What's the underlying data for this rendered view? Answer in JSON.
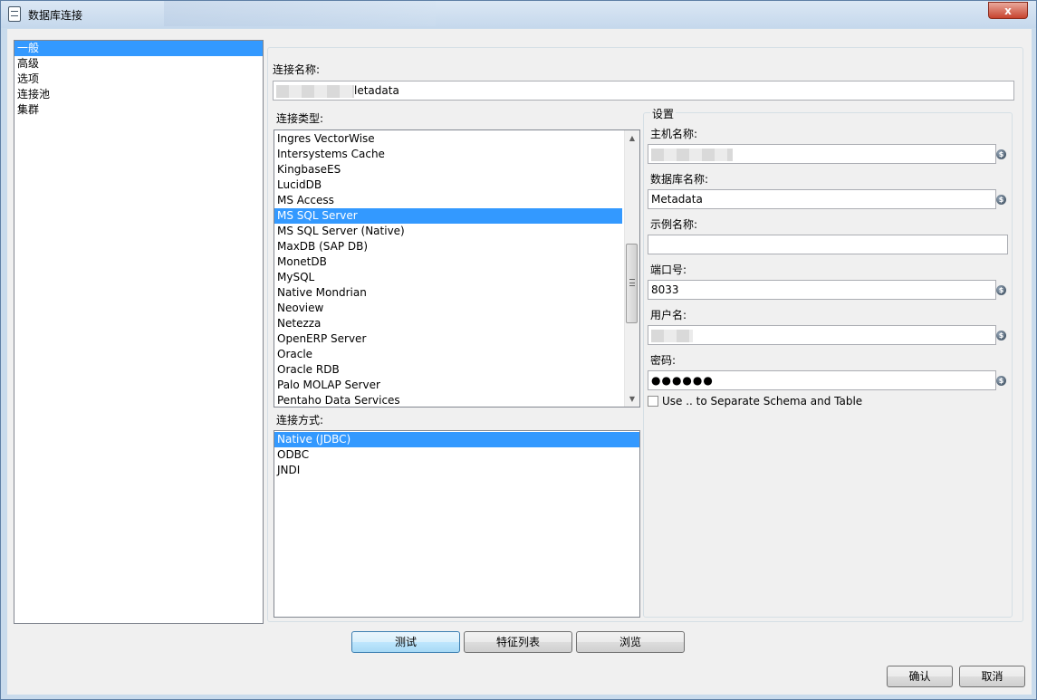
{
  "window": {
    "title": "数据库连接",
    "close_symbol": "x"
  },
  "nav": {
    "items": [
      {
        "label": "一般",
        "selected": true
      },
      {
        "label": "高级",
        "selected": false
      },
      {
        "label": "选项",
        "selected": false
      },
      {
        "label": "连接池",
        "selected": false
      },
      {
        "label": "集群",
        "selected": false
      }
    ]
  },
  "connection_name": {
    "label": "连接名称:",
    "value": "letadata"
  },
  "connection_type": {
    "label": "连接类型:",
    "items": [
      "Ingres VectorWise",
      "Intersystems Cache",
      "KingbaseES",
      "LucidDB",
      "MS Access",
      "MS SQL Server",
      "MS SQL Server (Native)",
      "MaxDB (SAP DB)",
      "MonetDB",
      "MySQL",
      "Native Mondrian",
      "Neoview",
      "Netezza",
      "OpenERP Server",
      "Oracle",
      "Oracle RDB",
      "Palo MOLAP Server",
      "Pentaho Data Services"
    ],
    "selected": "MS SQL Server"
  },
  "access_method": {
    "label": "连接方式:",
    "items": [
      "Native (JDBC)",
      "ODBC",
      "JNDI"
    ],
    "selected": "Native (JDBC)"
  },
  "settings": {
    "group_label": "设置",
    "host": {
      "label": "主机名称:",
      "value": ""
    },
    "database": {
      "label": "数据库名称:",
      "value": "Metadata"
    },
    "instance": {
      "label": "示例名称:",
      "value": ""
    },
    "port": {
      "label": "端口号:",
      "value": "8033"
    },
    "username": {
      "label": "用户名:",
      "value": ""
    },
    "password": {
      "label": "密码:",
      "value": "●●●●●●"
    },
    "separate_schema": {
      "label": "Use .. to Separate Schema and Table",
      "checked": false
    },
    "variable_icon": "variable-icon"
  },
  "buttons": {
    "test": "测试",
    "feature_list": "特征列表",
    "explore": "浏览",
    "ok": "确认",
    "cancel": "取消"
  },
  "colors": {
    "selection": "#3399ff",
    "window_frame": "#c9dbec",
    "close_button": "#c7432e"
  }
}
